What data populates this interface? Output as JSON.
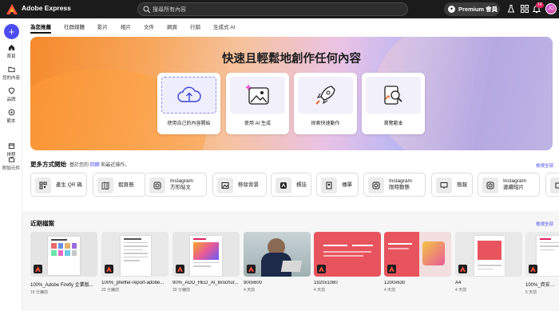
{
  "app": {
    "title": "Adobe Express"
  },
  "search": {
    "placeholder": "搜尋所有內容"
  },
  "topbar": {
    "premium_label": "Premium 會員",
    "notification_count": "14",
    "avatar_initials": "JO"
  },
  "rail": {
    "create_label": "+",
    "items": [
      {
        "label": "首頁",
        "icon": "home-icon"
      },
      {
        "label": "您的內容",
        "icon": "folder-icon"
      },
      {
        "label": "品牌",
        "icon": "brand-icon"
      },
      {
        "label": "範本",
        "icon": "templates-icon"
      },
      {
        "label": "排程",
        "icon": "calendar-icon"
      },
      {
        "label": "附加元件",
        "icon": "addons-icon"
      }
    ]
  },
  "tabs": [
    {
      "label": "為您推薦",
      "active": true
    },
    {
      "label": "社群媒體"
    },
    {
      "label": "影片"
    },
    {
      "label": "相片"
    },
    {
      "label": "文件"
    },
    {
      "label": "網頁"
    },
    {
      "label": "行銷"
    },
    {
      "label": "生成式 AI"
    }
  ],
  "hero": {
    "title": "快速且輕鬆地創作任何內容",
    "cards": [
      {
        "label": "使用自己的內容開始",
        "icon": "upload-cloud-icon"
      },
      {
        "label": "使用 AI 生成",
        "icon": "ai-image-icon"
      },
      {
        "label": "探索快速動作",
        "icon": "rocket-icon"
      },
      {
        "label": "瀏覽範本",
        "icon": "search-template-icon"
      }
    ]
  },
  "more_ways": {
    "title": "更多方式開始",
    "subtitle_prefix": "基於您的",
    "subtitle_link": "回饋",
    "subtitle_suffix": "和最近操作。",
    "view_all": "檢視全部",
    "items": [
      {
        "label": "產生 QR 碼",
        "icon": "qr-code-icon"
      },
      {
        "label": "摺頁冊",
        "icon": "brochure-icon"
      },
      {
        "label": "Instagram\n方形貼文",
        "icon": "instagram-icon"
      },
      {
        "label": "移除背景",
        "icon": "remove-background-icon"
      },
      {
        "label": "標誌",
        "icon": "logo-icon"
      },
      {
        "label": "傳單",
        "icon": "flyer-icon"
      },
      {
        "label": "Instagram\n限時動態",
        "icon": "instagram-story-icon"
      },
      {
        "label": "簡報",
        "icon": "presentation-icon"
      },
      {
        "label": "Instagram\n連續短片",
        "icon": "instagram-reel-icon"
      }
    ]
  },
  "recent": {
    "title": "近期檔案",
    "view_all": "檢視全部",
    "files": [
      {
        "name": "100%_Adobe Firefly 企業版...",
        "time": "19 分鐘前"
      },
      {
        "name": "100%_pfeiffer-report-adobe...",
        "time": "20 分鐘前"
      },
      {
        "name": "90%_ADO_HED_AI_Brochur...",
        "time": "39 分鐘前"
      },
      {
        "name": "900x600",
        "time": "4 天前"
      },
      {
        "name": "1920x1080",
        "time": "4 天前"
      },
      {
        "name": "1200x630",
        "time": "4 天前"
      },
      {
        "name": "A4",
        "time": "4 天前"
      },
      {
        "name": "100%_資安自我審...",
        "time": "5 天前"
      }
    ]
  },
  "colors": {
    "accent": "#4b4df2",
    "topbar": "#1b1b1b"
  }
}
